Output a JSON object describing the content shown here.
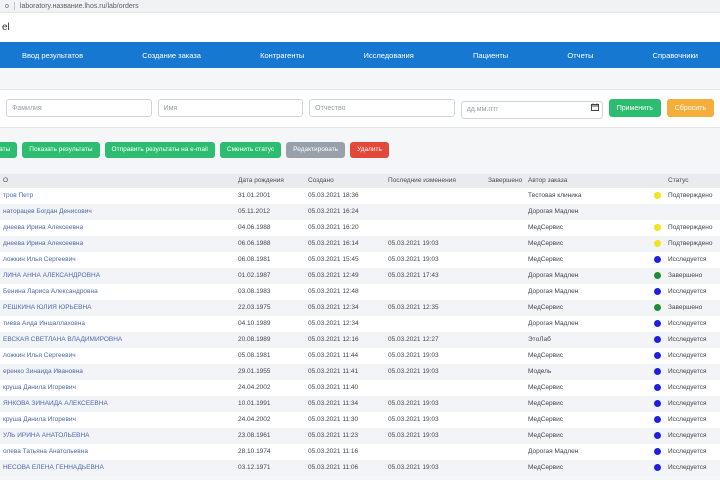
{
  "browser": {
    "tab_fragment": "о",
    "url": "laboratory.название.lhos.ru/lab/orders"
  },
  "brand": {
    "logo_fragment": "el"
  },
  "nav": {
    "items": [
      {
        "label": "Ввод результатов"
      },
      {
        "label": "Создание заказа"
      },
      {
        "label": "Контрагенты"
      },
      {
        "label": "Исследования"
      },
      {
        "label": "Пациенты"
      },
      {
        "label": "Отчеты"
      },
      {
        "label": "Справочники"
      }
    ]
  },
  "filters": {
    "surname_placeholder": "Фамилия",
    "name_placeholder": "Имя",
    "patronymic_placeholder": "Отчество",
    "date_placeholder": "дд.мм.гггг",
    "apply_label": "Применить",
    "reset_label": "Сбросить"
  },
  "actions": {
    "print_label": "Печатать результаты",
    "show_results_label": "Показать результаты",
    "send_email_label": "Отправить результаты на e-mail",
    "change_status_label": "Сменить статус",
    "edit_label": "Редактировать",
    "delete_label": "Удалить"
  },
  "table": {
    "headers": {
      "fio": "О",
      "dob": "Дата рождения",
      "created": "Создано",
      "modified": "Последние изменения",
      "completed": "Завершено",
      "author": "Автор заказа",
      "status": "Статус"
    },
    "rows": [
      {
        "name": "тров Петр",
        "dob": "31.01.2001",
        "created": "05.03.2021 18:36",
        "modified": "",
        "completed": "",
        "author": "Тестовая клиника",
        "dot": "yellow",
        "status": "Подтверждено"
      },
      {
        "name": "наторацев Богдан Денисович",
        "dob": "05.11.2012",
        "created": "05.03.2021 16:24",
        "modified": "",
        "completed": "",
        "author": "Дорогая Мадлен",
        "dot": null,
        "status": ""
      },
      {
        "name": "днеева Ирина Алексеевна",
        "dob": "04.06.1988",
        "created": "05.03.2021 16:20",
        "modified": "",
        "completed": "",
        "author": "МедСервис",
        "dot": "yellow",
        "status": "Подтверждено"
      },
      {
        "name": "днеева Ирина Алексеевна",
        "dob": "06.06.1988",
        "created": "05.03.2021 16:14",
        "modified": "05.03.2021 19:03",
        "completed": "",
        "author": "МедСервис",
        "dot": "yellow",
        "status": "Подтверждено"
      },
      {
        "name": "ложкин Илья Сергеевич",
        "dob": "06.08.1981",
        "created": "05.03.2021 15:45",
        "modified": "05.03.2021 19:03",
        "completed": "",
        "author": "МедСервис",
        "dot": "blue",
        "status": "Исследуется"
      },
      {
        "name": "ЛИНА АННА АЛЕКСАНДРОВНА",
        "dob": "01.02.1987",
        "created": "05.03.2021 12:49",
        "modified": "05.03.2021 17:43",
        "completed": "",
        "author": "Дорогая Мадлен",
        "dot": "green",
        "status": "Завершено"
      },
      {
        "name": "Бенина Лариса Александровна",
        "dob": "03.08.1983",
        "created": "05.03.2021 12:48",
        "modified": "",
        "completed": "",
        "author": "Дорогая Мадлен",
        "dot": "blue",
        "status": "Исследуется"
      },
      {
        "name": "РЕШКИНА ЮЛИЯ ЮРЬЕВНА",
        "dob": "22.03.1975",
        "created": "05.03.2021 12:34",
        "modified": "05.03.2021 12:35",
        "completed": "",
        "author": "МедСервис",
        "dot": "green",
        "status": "Завершено"
      },
      {
        "name": "тиева Аида Иншаллаховна",
        "dob": "04.10.1989",
        "created": "05.03.2021 12:34",
        "modified": "",
        "completed": "",
        "author": "Дорогая Мадлен",
        "dot": "blue",
        "status": "Исследуется"
      },
      {
        "name": "ЕВСКАЯ СВЕТЛАНА ВЛАДИМИРОВНА",
        "dob": "20.08.1989",
        "created": "05.03.2021 12:16",
        "modified": "05.03.2021 12:27",
        "completed": "",
        "author": "ЭтоЛаб",
        "dot": "blue",
        "status": "Исследуется"
      },
      {
        "name": "ложкин Илья Сергеевич",
        "dob": "05.08.1981",
        "created": "05.03.2021 11:44",
        "modified": "05.03.2021 19:03",
        "completed": "",
        "author": "МедСервис",
        "dot": "blue",
        "status": "Исследуется"
      },
      {
        "name": "еренко Зинаида Ивановна",
        "dob": "29.01.1955",
        "created": "05.03.2021 11:41",
        "modified": "05.03.2021 19:03",
        "completed": "",
        "author": "Модель",
        "dot": "blue",
        "status": "Исследуется"
      },
      {
        "name": "круша Данила Игоревич",
        "dob": "24.04.2002",
        "created": "05.03.2021 11:40",
        "modified": "",
        "completed": "",
        "author": "МедСервис",
        "dot": "blue",
        "status": "Исследуется"
      },
      {
        "name": "ЯНКОВА ЗИНАИДА АЛЕКСЕЕВНА",
        "dob": "10.01.1991",
        "created": "05.03.2021 11:34",
        "modified": "05.03.2021 19:03",
        "completed": "",
        "author": "МедСервис",
        "dot": "blue",
        "status": "Исследуется"
      },
      {
        "name": "круша Данила Игоревич",
        "dob": "24.04.2002",
        "created": "05.03.2021 11:30",
        "modified": "05.03.2021 19:03",
        "completed": "",
        "author": "МедСервис",
        "dot": "blue",
        "status": "Исследуется"
      },
      {
        "name": "УЛЬ ИРИНА АНАТОЛЬЕВНА",
        "dob": "23.08.1961",
        "created": "05.03.2021 11:23",
        "modified": "05.03.2021 19:03",
        "completed": "",
        "author": "МедСервис",
        "dot": "blue",
        "status": "Исследуется"
      },
      {
        "name": "олева Татьяна Анатольевна",
        "dob": "28.10.1974",
        "created": "05.03.2021 11:16",
        "modified": "",
        "completed": "",
        "author": "Дорогая Мадлен",
        "dot": "blue",
        "status": "Исследуется"
      },
      {
        "name": "НЕСОВА ЕЛЕНА ГЕННАДЬЕВНА",
        "dob": "03.12.1971",
        "created": "05.03.2021 11:06",
        "modified": "05.03.2021 19:03",
        "completed": "",
        "author": "МедСервис",
        "dot": "blue",
        "status": "Исследуется"
      }
    ]
  },
  "colors": {
    "navbar_blue": "#1778d2",
    "button_green": "#2dbd71",
    "button_orange": "#f3ae3c",
    "button_gray": "#98a1aa",
    "button_red": "#e2493b",
    "link_blue": "#4a69b1",
    "dots": {
      "yellow": "#f2e41c",
      "blue": "#2121dd",
      "green": "#1e8f35"
    }
  }
}
